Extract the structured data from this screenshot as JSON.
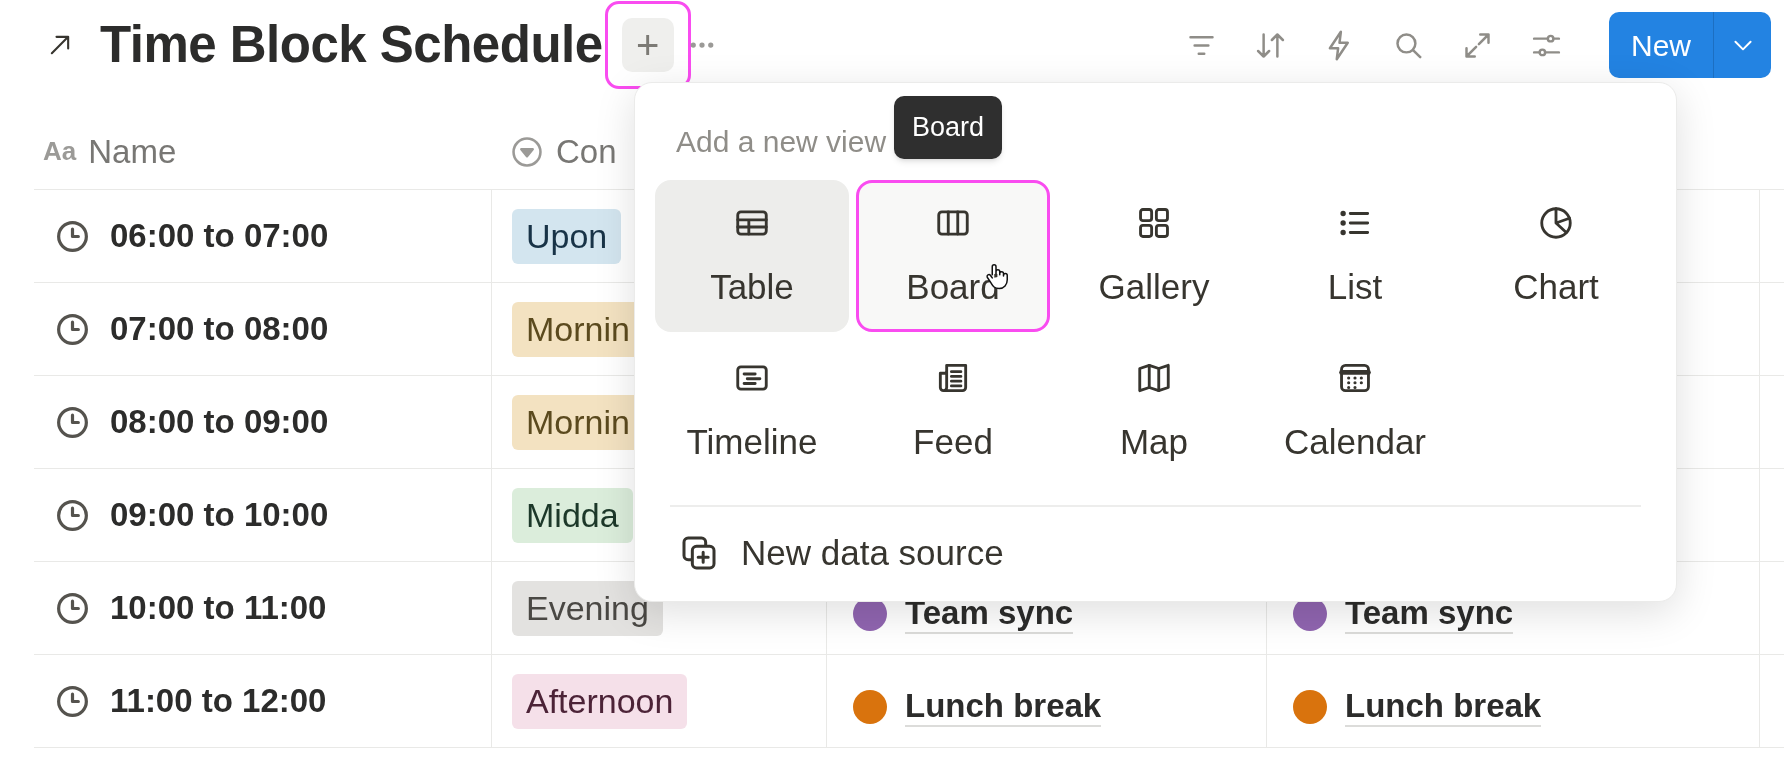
{
  "header": {
    "title": "Time Block Schedule",
    "add_button": {
      "label": "+",
      "highlighted": true
    },
    "new_button": {
      "label": "New"
    }
  },
  "table": {
    "columns": [
      {
        "type_glyph": "Aa",
        "label": "Name"
      },
      {
        "label": "Con"
      }
    ],
    "rows": [
      {
        "name": "06:00 to 07:00",
        "tag": {
          "label": "Upon",
          "color": "#d3e5ef"
        }
      },
      {
        "name": "07:00 to 08:00",
        "tag": {
          "label": "Mornin",
          "color": "#f3e2c1"
        }
      },
      {
        "name": "08:00 to 09:00",
        "tag": {
          "label": "Mornin",
          "color": "#f3e2c1"
        }
      },
      {
        "name": "09:00 to 10:00",
        "tag": {
          "label": "Midda",
          "color": "#dbeddb"
        }
      },
      {
        "name": "10:00 to 11:00",
        "tag": {
          "label": "Evening",
          "color": "#e3e2e0"
        },
        "events": [
          {
            "label": "Team sync",
            "color": "#9065b0"
          },
          {
            "label": "Team sync",
            "color": "#9065b0"
          }
        ]
      },
      {
        "name": "11:00 to 12:00",
        "tag": {
          "label": "Afternoon",
          "color": "#f5e0e9"
        },
        "events": [
          {
            "label": "Lunch break",
            "color": "#d9730d"
          },
          {
            "label": "Lunch break",
            "color": "#d9730d"
          }
        ]
      }
    ]
  },
  "view_menu": {
    "heading": "Add a new view",
    "tooltip": "Board",
    "views": [
      {
        "kind": "table",
        "label": "Table",
        "selected": true,
        "highlighted": false
      },
      {
        "kind": "board",
        "label": "Board",
        "selected": false,
        "highlighted": true
      },
      {
        "kind": "gallery",
        "label": "Gallery",
        "selected": false,
        "highlighted": false
      },
      {
        "kind": "list",
        "label": "List",
        "selected": false,
        "highlighted": false
      },
      {
        "kind": "chart",
        "label": "Chart",
        "selected": false,
        "highlighted": false
      },
      {
        "kind": "timeline",
        "label": "Timeline",
        "selected": false,
        "highlighted": false
      },
      {
        "kind": "feed",
        "label": "Feed",
        "selected": false,
        "highlighted": false
      },
      {
        "kind": "map",
        "label": "Map",
        "selected": false,
        "highlighted": false
      },
      {
        "kind": "calendar",
        "label": "Calendar",
        "selected": false,
        "highlighted": false
      }
    ],
    "footer_action": "New data source"
  }
}
